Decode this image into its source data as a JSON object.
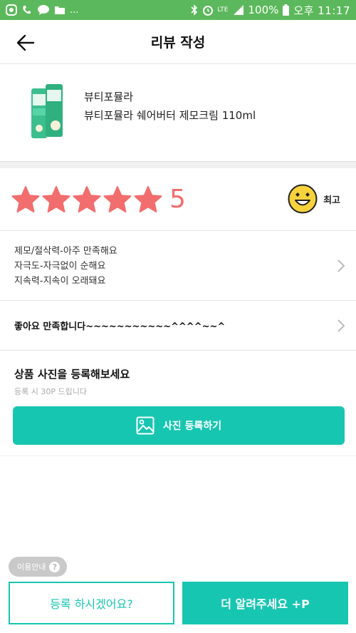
{
  "status_bar": {
    "battery": "100%",
    "time": "오후 11:17",
    "network": "LTE",
    "left_icons": [
      "phone-app-icon",
      "missed-call-icon",
      "talk-icon",
      "folder-icon",
      "more-dots"
    ],
    "right_icons": [
      "bluetooth-icon",
      "alarm-icon",
      "lte-icon",
      "signal-icon",
      "battery-icon"
    ],
    "more_dots": "..."
  },
  "header": {
    "title": "리뷰 작성",
    "back_icon": "arrow-left-icon"
  },
  "product": {
    "brand": "뷰티포뮬라",
    "name": "뷰티포뮬라 쉐어버터 제모크림 110ml"
  },
  "rating": {
    "score": "5",
    "star_count": 5,
    "caption": "최고",
    "star_color": "#f26d6d",
    "emoji": "grinning-face-icon"
  },
  "evaluation": {
    "lines": [
      "제모/절삭력-아주 만족해요",
      "자극도-자극없이 순해요",
      "지속력-지속이 오래돼요"
    ]
  },
  "comment": {
    "text": "좋아요 만족합니다~~~~~~~~~~~^^^^~~^"
  },
  "photo": {
    "title": "상품 사진을 등록해보세요",
    "subtitle": "등록 시 30P 드립니다",
    "button_label": "사진 등록하기",
    "icon": "image-icon"
  },
  "footer": {
    "guide_label": "이용안내",
    "help_glyph": "?",
    "submit_label": "등록 하시겠어요?",
    "more_label": "더 알려주세요 +P"
  },
  "colors": {
    "accent": "#17c6b1",
    "status_bar": "#5cb85c",
    "star": "#f26d6d"
  }
}
